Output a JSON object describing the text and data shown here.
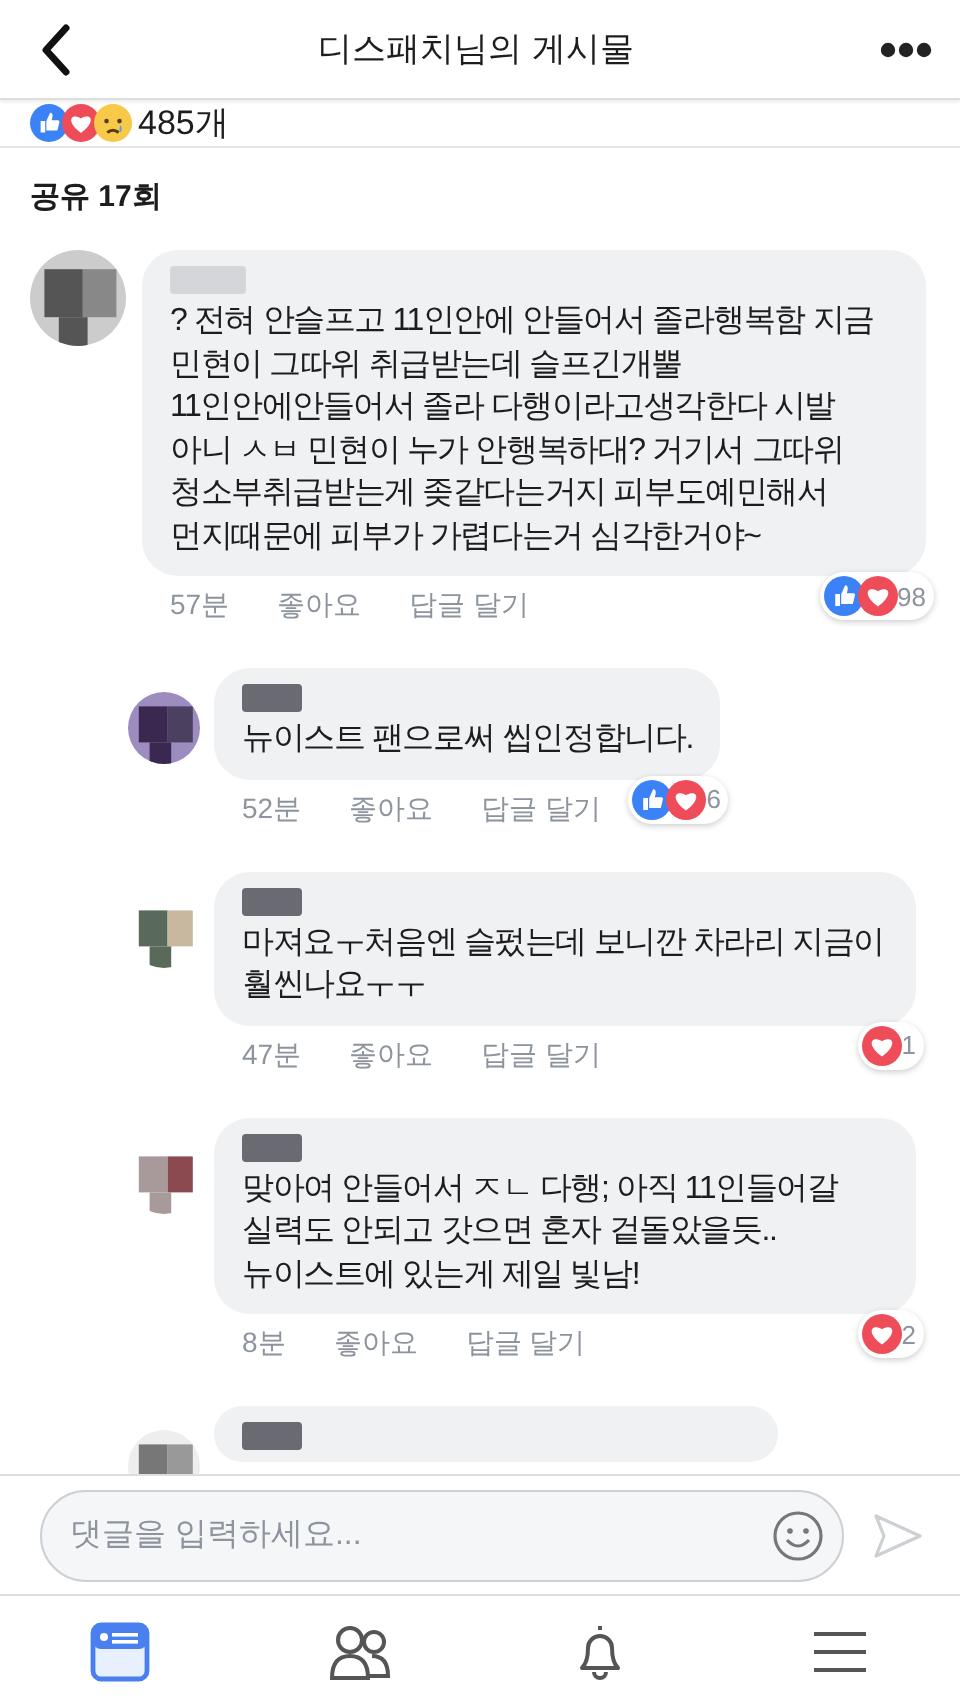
{
  "header": {
    "title": "디스패치님의 게시물"
  },
  "reactions": {
    "icons": [
      {
        "kind": "like"
      },
      {
        "kind": "love"
      },
      {
        "kind": "sad"
      }
    ],
    "count": "485개"
  },
  "shares": "공유 17회",
  "comments": [
    {
      "text": "? 전혀 안슬프고 11인안에 안들어서 졸라행복함 지금 민현이 그따위 취급받는데 슬프긴개뿔 11인안에안들어서 졸라 다행이라고생각한다 시발\n아니 ㅅㅂ 민현이 누가 안행복하대? 거기서 그따위 청소부취급받는게 좆같다는거지 피부도예민해서 먼지때문에 피부가 가렵다는거 심각한거야~",
      "time": "57분",
      "like": "좋아요",
      "reply": "답글 달기",
      "reactions": {
        "icons": [
          {
            "kind": "like"
          },
          {
            "kind": "love"
          }
        ],
        "count": "98"
      },
      "children": [
        {
          "text": "뉴이스트 팬으로써 씹인정합니다.",
          "time": "52분",
          "like": "좋아요",
          "reply": "답글 달기",
          "reactions": {
            "icons": [
              {
                "kind": "like"
              },
              {
                "kind": "love"
              }
            ],
            "count": "6"
          }
        },
        {
          "text": "마져요ㅜ처음엔 슬펐는데 보니깐 차라리 지금이 훨씬나요ㅜㅜ",
          "time": "47분",
          "like": "좋아요",
          "reply": "답글 달기",
          "reactions": {
            "icons": [
              {
                "kind": "love"
              }
            ],
            "count": "1"
          }
        },
        {
          "text": "맞아여 안들어서 ㅈㄴ 다행; 아직 11인들어갈 실력도 안되고 갓으면 혼자 겉돌았을듯.. 뉴이스트에 있는게 제일 빛남!",
          "time": "8분",
          "like": "좋아요",
          "reply": "답글 달기",
          "reactions": {
            "icons": [
              {
                "kind": "love"
              }
            ],
            "count": "2"
          }
        },
        {
          "kind": "partial"
        }
      ]
    }
  ],
  "composer": {
    "placeholder": "댓글을 입력하세요..."
  },
  "nav": [
    {
      "selected": true
    },
    {
      "selected": false
    },
    {
      "selected": false
    },
    {
      "selected": false
    }
  ]
}
